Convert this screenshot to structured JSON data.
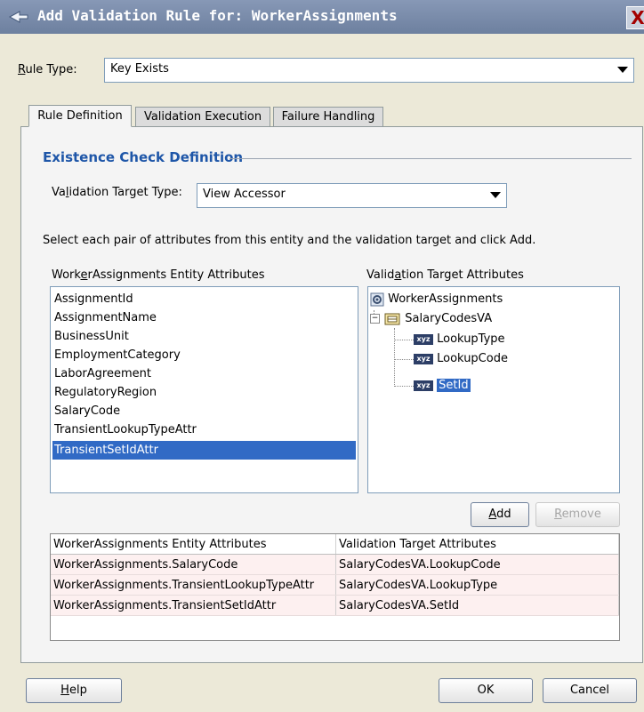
{
  "dialog": {
    "title": "Add Validation Rule for: WorkerAssignments",
    "close_glyph": "X"
  },
  "rule_type": {
    "label_prefix": "R",
    "label_rest": "ule Type:",
    "value": "Key Exists"
  },
  "tabs": [
    {
      "label": "Rule Definition",
      "active": true
    },
    {
      "label": "Validation Execution",
      "active": false
    },
    {
      "label": "Failure Handling",
      "active": false
    }
  ],
  "section": {
    "title": "Existence Check Definition"
  },
  "target_type": {
    "label_a": "Va",
    "label_mn": "l",
    "label_b": "idation Target Type:",
    "value": "View Accessor"
  },
  "instruction": "Select each pair of attributes from this entity and the validation target and click Add.",
  "entity_list": {
    "label_a": "Work",
    "label_mn": "e",
    "label_b": "rAssignments Entity Attributes",
    "items": [
      "AssignmentId",
      "AssignmentName",
      "BusinessUnit",
      "EmploymentCategory",
      "LaborAgreement",
      "RegulatoryRegion",
      "SalaryCode",
      "TransientLookupTypeAttr",
      "TransientSetIdAttr"
    ],
    "selected_index": 8
  },
  "target_tree": {
    "label_a": "Valid",
    "label_mn": "a",
    "label_b": "tion Target Attributes",
    "root": "WorkerAssignments",
    "accessor": "SalaryCodesVA",
    "children": [
      "LookupType",
      "LookupCode",
      "SetId"
    ],
    "selected": "SetId",
    "attr_icon_text": "xyz"
  },
  "buttons": {
    "add": {
      "mn": "A",
      "rest": "dd"
    },
    "remove": {
      "mn": "R",
      "rest": "emove"
    },
    "help": {
      "mn": "H",
      "rest": "elp"
    },
    "ok": "OK",
    "cancel": "Cancel"
  },
  "pairs_table": {
    "headers": [
      "WorkerAssignments Entity Attributes",
      "Validation Target Attributes"
    ],
    "rows": [
      [
        "WorkerAssignments.SalaryCode",
        "SalaryCodesVA.LookupCode"
      ],
      [
        "WorkerAssignments.TransientLookupTypeAttr",
        "SalaryCodesVA.LookupType"
      ],
      [
        "WorkerAssignments.TransientSetIdAttr",
        "SalaryCodesVA.SetId"
      ]
    ]
  }
}
